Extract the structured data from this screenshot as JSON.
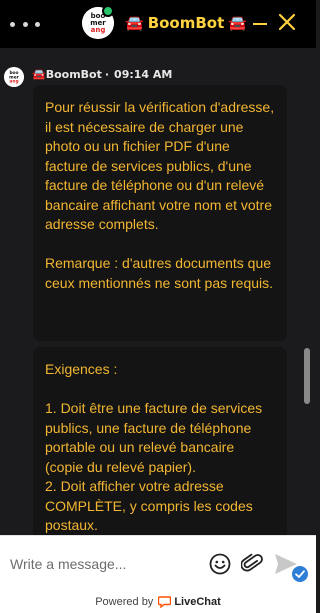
{
  "header": {
    "title": "BoomBot",
    "title_emoji": "🚘",
    "avatar_text": [
      "boo",
      "mer",
      "ang"
    ],
    "status_color": "#28c36b",
    "accent_color": "#ffd23f"
  },
  "message": {
    "sender": "🚘BoomBot",
    "separator": "·",
    "time": "09:14 AM",
    "bubbles": [
      "Pour réussir la vérification d'adresse, il est nécessaire de charger une photo ou un fichier PDF d'une facture de services publics, d'une facture de téléphone ou d'un relevé bancaire affichant votre nom et votre adresse complets.\n\nRemarque : d'autres documents que ceux mentionnés ne sont pas requis.",
      "Exigences :\n\n1. Doit être une facture de services publics, une facture de téléphone portable ou un relevé bancaire (copie du relevé papier).\n2. Doit afficher votre adresse COMPLÈTE, y compris les codes postaux."
    ],
    "text_color": "#f2b632"
  },
  "composer": {
    "placeholder": "Write a message...",
    "emoji_icon": "smiley-icon",
    "attach_icon": "paperclip-icon",
    "send_icon": "send-icon"
  },
  "footer": {
    "powered_by": "Powered by",
    "brand": "LiveChat",
    "brand_color": "#ff5100"
  }
}
